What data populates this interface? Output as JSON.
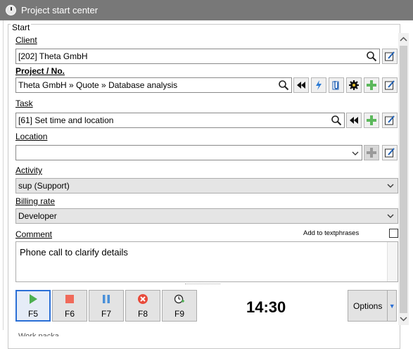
{
  "window": {
    "title": "Project start center"
  },
  "group": {
    "legend": "Start"
  },
  "client": {
    "label": "Client",
    "value": "[202] Theta GmbH"
  },
  "project": {
    "label": "Project / No.",
    "value": "Theta GmbH » Quote » Database analysis"
  },
  "task": {
    "label": "Task",
    "value": "[61] Set time and location"
  },
  "location": {
    "label": "Location",
    "value": ""
  },
  "activity": {
    "label": "Activity",
    "value": "sup (Support)"
  },
  "billing": {
    "label": "Billing rate",
    "value": "Developer"
  },
  "comment": {
    "label": "Comment",
    "add_textphrase_label": "Add to textphrases",
    "value": "Phone call to clarify details"
  },
  "fkeys": [
    {
      "label": "F5",
      "icon": "play-icon",
      "color": "#4caf50"
    },
    {
      "label": "F6",
      "icon": "stop-icon",
      "color": "#f06a5a"
    },
    {
      "label": "F7",
      "icon": "pause-icon",
      "color": "#4a90d9"
    },
    {
      "label": "F8",
      "icon": "cancel-icon",
      "color": "#e84a3a"
    },
    {
      "label": "F9",
      "icon": "timer-add-icon",
      "color": "#4caf50"
    }
  ],
  "timer": {
    "value": "14:30"
  },
  "options": {
    "label": "Options"
  },
  "footer": {
    "text": "Work packa..."
  }
}
